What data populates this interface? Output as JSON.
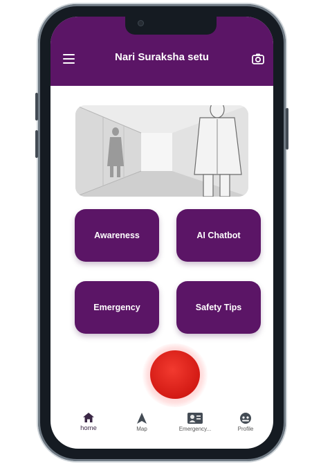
{
  "app": {
    "title": "Nari Suraksha setu"
  },
  "header": {
    "menu_icon": "hamburger-menu-icon",
    "camera_icon": "camera-icon"
  },
  "home": {
    "tiles": [
      {
        "label": "Awareness"
      },
      {
        "label": "AI Chatbot"
      },
      {
        "label": "Emergency"
      },
      {
        "label": "Safety Tips"
      }
    ],
    "sos_color": "#d31a14"
  },
  "bottom_nav": {
    "items": [
      {
        "label": "home",
        "icon": "home-icon"
      },
      {
        "label": "Map",
        "icon": "navigation-arrow-icon"
      },
      {
        "label": "Emergency...",
        "icon": "contact-card-icon"
      },
      {
        "label": "Profile",
        "icon": "profile-avatar-icon"
      }
    ]
  },
  "colors": {
    "primary": "#5b1566",
    "sos": "#d31a14",
    "background": "#ffffff"
  }
}
